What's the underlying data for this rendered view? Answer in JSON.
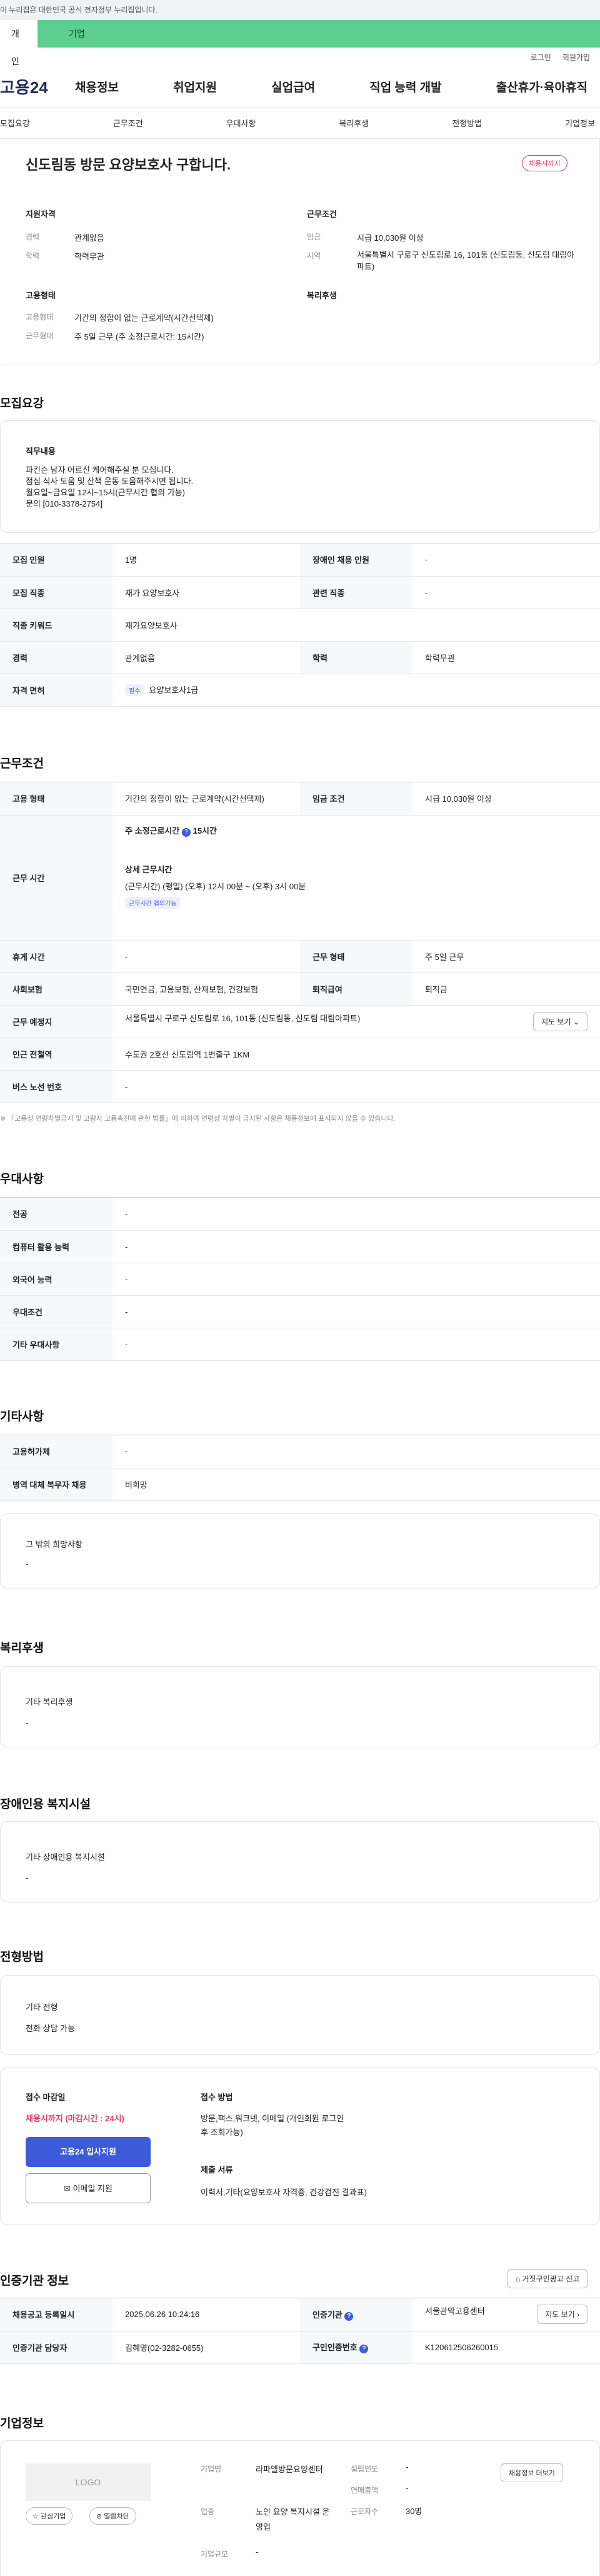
{
  "gov_banner": "이 누리집은 대한민국 공식 전자정부 누리집입니다.",
  "top_tabs": {
    "personal": "개인",
    "corporate": "기업"
  },
  "util": {
    "login": "로그인",
    "signup": "회원가입"
  },
  "logo": "고용24",
  "gnb": [
    "채용정보",
    "취업지원",
    "실업급여",
    "직업 능력 개발",
    "출산휴가·육아휴직"
  ],
  "subnav": [
    "모집요강",
    "근무조건",
    "우대사항",
    "복리후생",
    "전형방법",
    "기업정보"
  ],
  "header": {
    "title": "신도림동 방문 요양보호사 구합니다.",
    "badge": "채용시까지",
    "qual_title": "지원자격",
    "career_label": "경력",
    "career_value": "관계없음",
    "edu_label": "학력",
    "edu_value": "학력무관",
    "emp_title": "고용형태",
    "emptype_label": "고용형태",
    "emptype_value": "기간의 정함이 없는 근로계약(시간선택제)",
    "work_label": "근무형태",
    "work_value": "주 5일 근무 (주 소정근로시간: 15시간)",
    "cond_title": "근무조건",
    "wage_label": "임금",
    "wage_value": "시급 10,030원 이상",
    "region_label": "지역",
    "region_value": "서울특별시 구로구 신도림로 16, 101동 (신도림동, 신도림 대림아파트)",
    "welfare_title": "복리후생"
  },
  "recruit": {
    "title": "모집요강",
    "job_title": "직무내용",
    "job_lines": [
      "파킨슨 남자 어르신 케어해주실 분 모십니다.",
      "점심 식사 도움 및 산책 운동 도움해주시면 됩니다.",
      "월요일~금요일 12시~15시(근무시간 협의 가능)",
      "문의 [010-3378-2754]"
    ],
    "rows": [
      [
        "모집 인원",
        "1명",
        "장애인 채용 인원",
        "-"
      ],
      [
        "모집 직종",
        "재가 요양보호사",
        "관련 직종",
        "-"
      ],
      [
        "직종 키워드",
        "재가요양보호사",
        "",
        ""
      ],
      [
        "경력",
        "관계없음",
        "학력",
        "학력무관"
      ]
    ],
    "license_label": "자격 면허",
    "license_chip": "필수",
    "license_value": "요양보호사1급"
  },
  "work": {
    "title": "근무조건",
    "emptype_label": "고용 형태",
    "emptype_value": "기간의 정함이 없는 근로계약(시간선택제)",
    "wage_label": "임금 조건",
    "wage_value": "시급 10,030원 이상",
    "hours_label": "근무 시간",
    "hours_week_label": "주 소정근로시간",
    "hours_week_value": "15시간",
    "hours_detail_title": "상세 근무시간",
    "hours_detail_value": "(근무시간) (평일) (오후) 12시 00분 ~ (오후) 3시 00분",
    "hours_chip": "근무시간 협의가능",
    "rest_label": "휴게 시간",
    "rest_value": "-",
    "form_label": "근무 형태",
    "form_value": "주 5일 근무",
    "insure_label": "사회보험",
    "insure_value": "국민연금, 고용보험, 산재보험, 건강보험",
    "retire_label": "퇴직급여",
    "retire_value": "퇴직금",
    "place_label": "근무 예정지",
    "place_value": "서울특별시 구로구 신도림로 16, 101동 (신도림동, 신도림 대림아파트)",
    "map_btn": "지도 보기",
    "subway_label": "인근 전철역",
    "subway_value": "수도권 2호선 신도림역 1번출구 1KM",
    "bus_label": "버스 노선 번호",
    "bus_value": "-",
    "note": "※ 『고용상 연령차별금지 및 고령자 고용촉진에 관한 법률』에 의하여 연령상 차별이 금지된 사항은 채용정보에 표시되지 않을 수 있습니다."
  },
  "pref": {
    "title": "우대사항",
    "rows": [
      [
        "전공",
        "-"
      ],
      [
        "컴퓨터 활용 능력",
        "-"
      ],
      [
        "외국어 능력",
        "-"
      ],
      [
        "우대조건",
        "-"
      ],
      [
        "기타 우대사항",
        "-"
      ]
    ]
  },
  "etc": {
    "title": "기타사항",
    "rows": [
      [
        "고용허가제",
        "-"
      ],
      [
        "병역 대체 복무자 채용",
        "비희망"
      ]
    ],
    "other_title": "그 밖의 희망사항",
    "other_value": "-"
  },
  "welfare": {
    "title": "복리후생",
    "box_title": "기타 복리후생",
    "box_value": "-"
  },
  "disabled": {
    "title": "장애인용 복지시설",
    "box_title": "기타 장애인용 복지시설",
    "box_value": "-"
  },
  "selection": {
    "title": "전형방법",
    "box_title": "기타 전형",
    "box_value": "전화 상담 가능",
    "deadline_title": "접수 마감일",
    "deadline_value": "채용시까지 (마감시간 : 24시)",
    "apply_btn": "고용24 입사지원",
    "email_btn": "이메일 지원",
    "method_title": "접수 방법",
    "method_value": "방문,팩스,워크넷, 이메일 (개인회원 로그인 후 조회가능)",
    "docs_title": "제출 서류",
    "docs_value": "이력서,기타(요양보호사 자격증, 건강검진 결과표)"
  },
  "agency": {
    "title": "인증기관 정보",
    "report_btn": "거짓구인광고 신고",
    "reg_label": "채용공고 등록일시",
    "reg_value": "2025.06.26 10:24:16",
    "agency_label": "인증기관",
    "agency_value": "서울관악고용센터",
    "map_btn": "지도 보기",
    "staff_label": "인증기관 담당자",
    "staff_value": "김혜영(02-3282-0655)",
    "no_label": "구인인증번호",
    "no_value": "K120612506260015"
  },
  "company": {
    "title": "기업정보",
    "logo_text": "LOGO",
    "fav_btn": "관심기업",
    "block_btn": "열람차단",
    "name_label": "기업명",
    "name_value": "라파엘방문요양센터",
    "type_label": "업종",
    "type_value": "노인 요양 복지시설 운영업",
    "size_label": "기업규모",
    "size_value": "-",
    "est_label": "설립연도",
    "est_value": "-",
    "sales_label": "연매출액",
    "sales_value": "-",
    "emp_label": "근로자수",
    "emp_value": "30명",
    "jobs_btn": "채용정보 더보기"
  }
}
